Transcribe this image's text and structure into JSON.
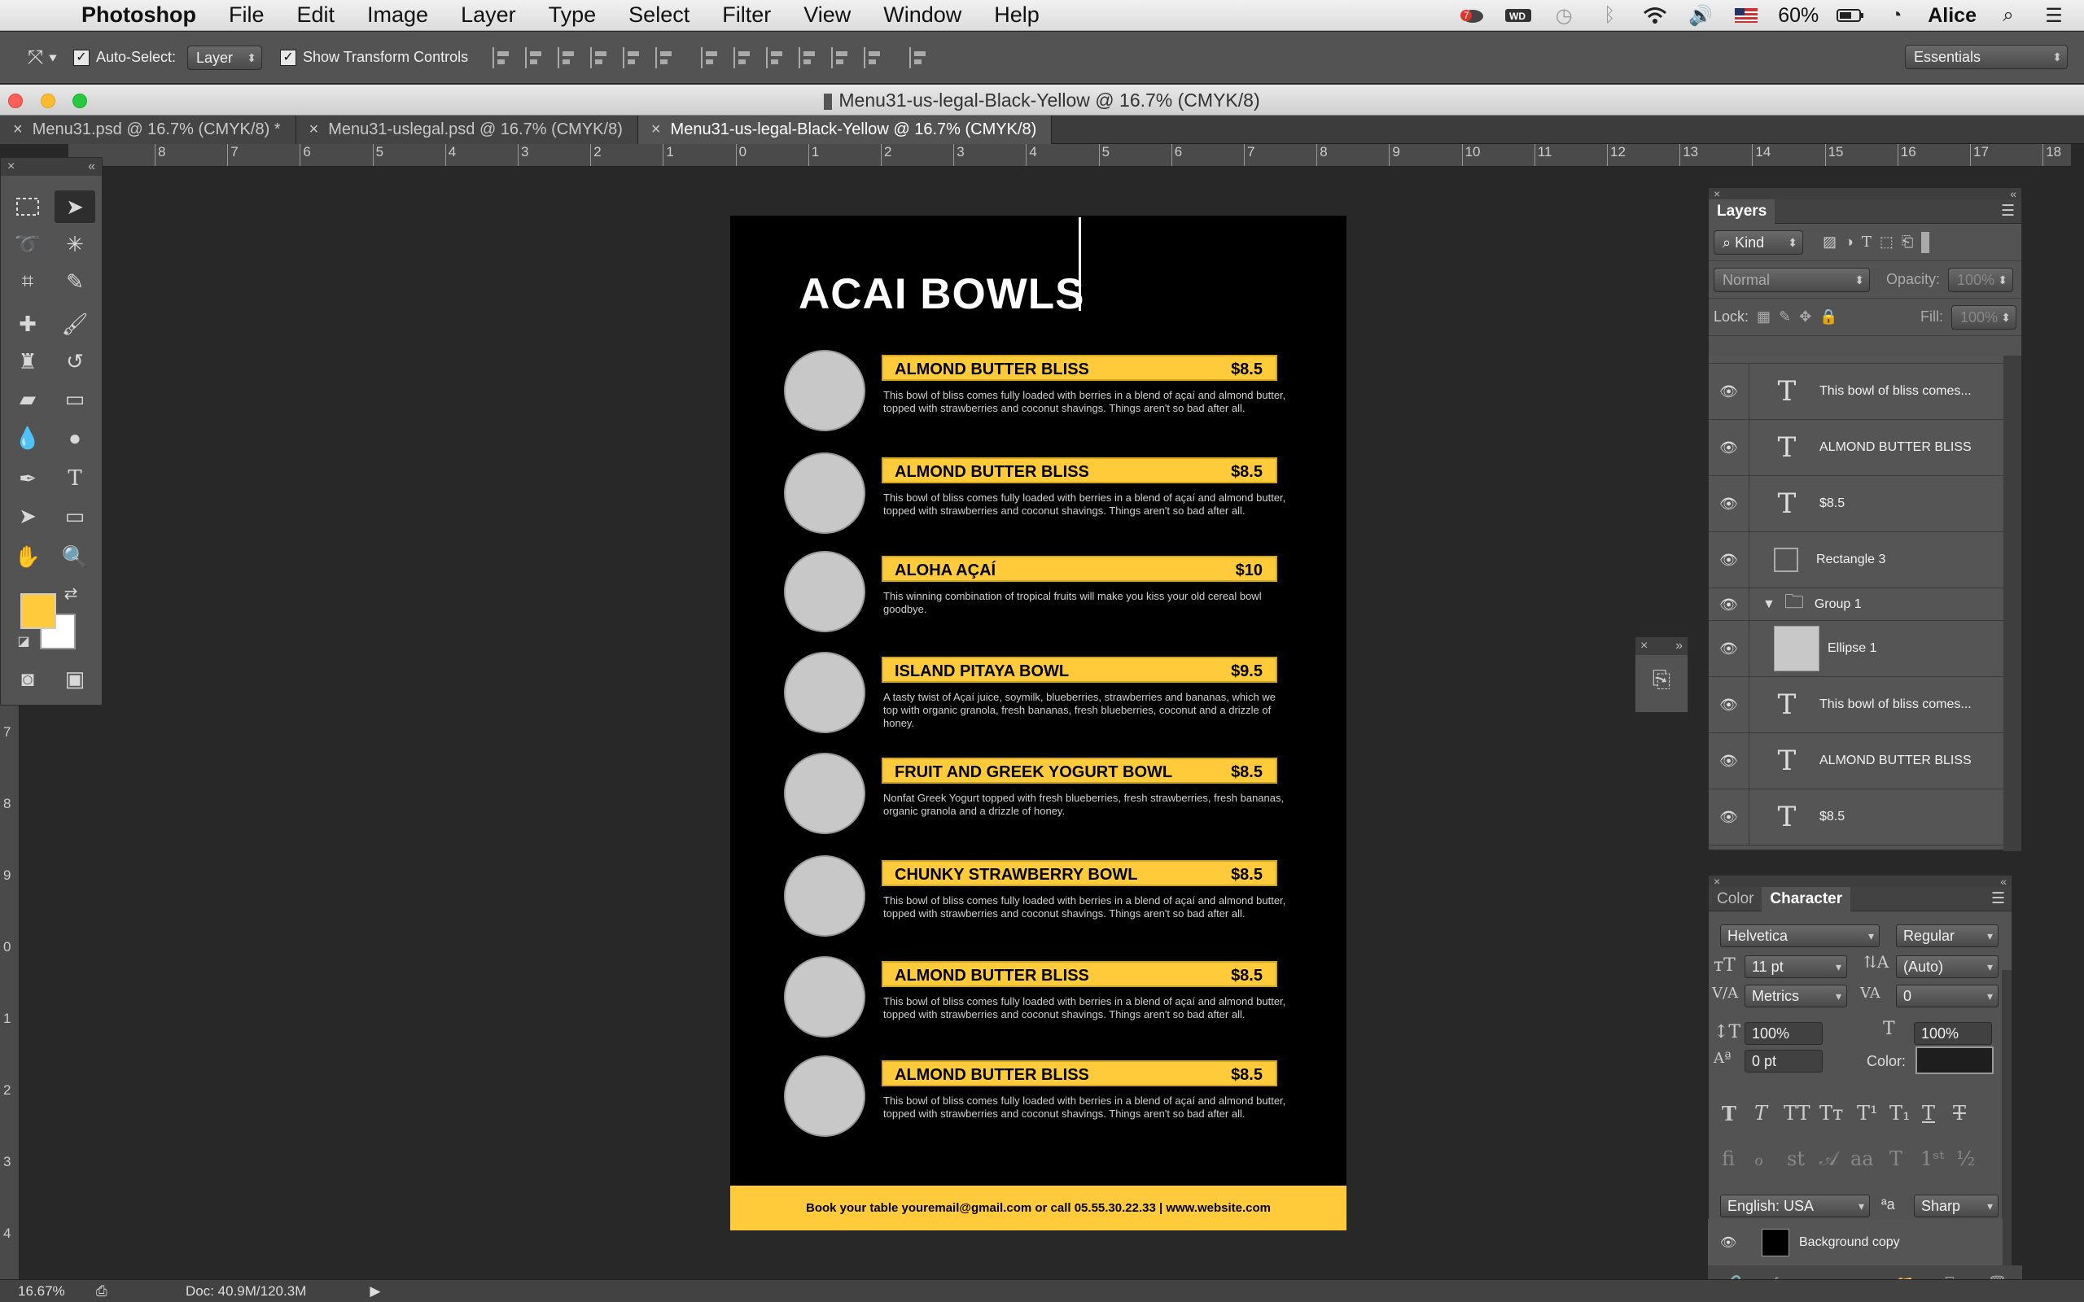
{
  "menubar": {
    "app": "Photoshop",
    "items": [
      "File",
      "Edit",
      "Image",
      "Layer",
      "Type",
      "Select",
      "Filter",
      "View",
      "Window",
      "Help"
    ],
    "battery": "60%",
    "user": "Alice",
    "badge": "7"
  },
  "options": {
    "auto_select_label": "Auto-Select:",
    "auto_select_value": "Layer",
    "transform_label": "Show Transform Controls",
    "workspace": "Essentials"
  },
  "window": {
    "title": "Menu31-us-legal-Black-Yellow @ 16.7% (CMYK/8)",
    "tabs": [
      "Menu31.psd @ 16.7% (CMYK/8) *",
      "Menu31-uslegal.psd @ 16.7% (CMYK/8)",
      "Menu31-us-legal-Black-Yellow @ 16.7% (CMYK/8)"
    ]
  },
  "ruler": {
    "h": [
      "8",
      "7",
      "6",
      "5",
      "4",
      "3",
      "2",
      "1",
      "0",
      "1",
      "2",
      "3",
      "4",
      "5",
      "6",
      "7",
      "8",
      "9",
      "10",
      "11",
      "12",
      "13",
      "14",
      "15",
      "16",
      "17",
      "18"
    ],
    "v": [
      "7",
      "8",
      "9",
      "0",
      "1",
      "2",
      "3",
      "4"
    ]
  },
  "document": {
    "title": "ACAI BOWLS",
    "items": [
      {
        "name": "ALMOND BUTTER BLISS",
        "price": "$8.5",
        "desc": "This bowl of bliss comes fully loaded with berries in a blend of açaí and almond butter, topped with strawberries and coconut shavings. Things aren't so bad after all."
      },
      {
        "name": "ALMOND BUTTER BLISS",
        "price": "$8.5",
        "desc": "This bowl of bliss comes fully loaded with berries in a blend of açaí and almond butter, topped with strawberries and coconut shavings. Things aren't so bad after all."
      },
      {
        "name": "ALOHA AÇAÍ",
        "price": "$10",
        "desc": "This winning combination of tropical fruits will make you kiss your old cereal bowl goodbye."
      },
      {
        "name": "ISLAND PITAYA BOWL",
        "price": "$9.5",
        "desc": "A tasty twist of Açaí juice, soymilk, blueberries, strawberries and bananas, which we top with organic granola, fresh bananas, fresh blueberries, coconut and a drizzle of honey."
      },
      {
        "name": "FRUIT AND GREEK YOGURT BOWL",
        "price": "$8.5",
        "desc": "Nonfat Greek Yogurt topped with fresh blueberries, fresh strawberries, fresh bananas, organic granola and a drizzle of honey."
      },
      {
        "name": "CHUNKY STRAWBERRY BOWL",
        "price": "$8.5",
        "desc": "This bowl of bliss comes fully loaded with berries in a blend of açaí and almond butter, topped with strawberries and coconut shavings. Things aren't so bad after all."
      },
      {
        "name": "ALMOND BUTTER BLISS",
        "price": "$8.5",
        "desc": "This bowl of bliss comes fully loaded with berries in a blend of açaí and almond butter, topped with strawberries and coconut shavings. Things aren't so bad after all."
      },
      {
        "name": "ALMOND BUTTER BLISS",
        "price": "$8.5",
        "desc": "This bowl of bliss comes fully loaded with berries in a blend of açaí and almond butter, topped with strawberries and coconut shavings. Things aren't so bad after all."
      }
    ],
    "footer": "Book your table  youremail@gmail.com or call 05.55.30.22.33 |  www.website.com"
  },
  "layers": {
    "title": "Layers",
    "filter": "Kind",
    "blend": "Normal",
    "opacity_label": "Opacity:",
    "opacity": "100%",
    "lock_label": "Lock:",
    "fill_label": "Fill:",
    "fill": "100%",
    "rows": [
      {
        "name": "This bowl of bliss comes...",
        "kind": "T"
      },
      {
        "name": "ALMOND BUTTER BLISS",
        "kind": "T"
      },
      {
        "name": "$8.5",
        "kind": "T"
      },
      {
        "name": "Rectangle 3",
        "kind": "shape"
      },
      {
        "name": "Group 1",
        "kind": "group"
      },
      {
        "name": "Ellipse 1",
        "kind": "ellipse"
      },
      {
        "name": "This bowl of bliss comes...",
        "kind": "T"
      },
      {
        "name": "ALMOND BUTTER BLISS",
        "kind": "T"
      },
      {
        "name": "$8.5",
        "kind": "T"
      }
    ],
    "bottom_layer": "Background copy"
  },
  "character": {
    "tabs": [
      "Color",
      "Character"
    ],
    "font": "Helvetica",
    "style": "Regular",
    "size": "11 pt",
    "leading": "(Auto)",
    "kerning": "Metrics",
    "tracking": "0",
    "vscale": "100%",
    "hscale": "100%",
    "baseline": "0 pt",
    "color_label": "Color:",
    "language": "English: USA",
    "aa_label": "ªa",
    "antialias": "Sharp"
  },
  "status": {
    "zoom": "16.67%",
    "doc": "Doc: 40.9M/120.3M"
  },
  "colors": {
    "accent": "#ffcb3a",
    "canvas": "#000000",
    "circle": "#c8c8c8"
  }
}
